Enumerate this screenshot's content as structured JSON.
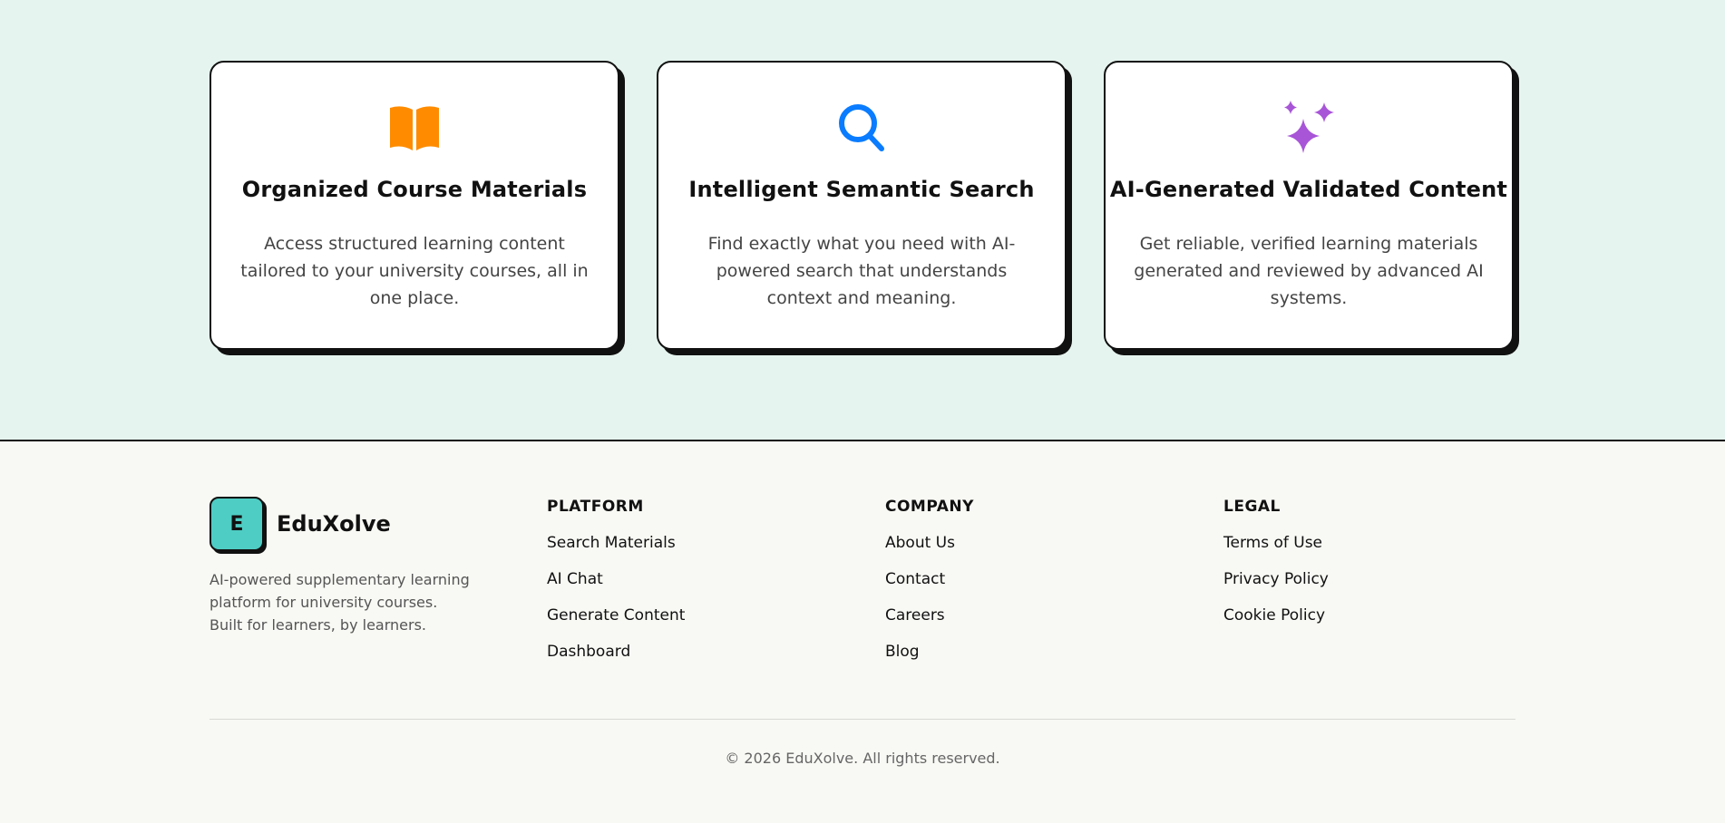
{
  "features": [
    {
      "icon": "open-book-icon",
      "icon_color": "#FF8C00",
      "title": "Organized Course Materials",
      "description": "Access structured learning content tailored to your university courses, all in one place."
    },
    {
      "icon": "search-icon",
      "icon_color": "#0A7CFF",
      "title": "Intelligent Semantic Search",
      "description": "Find exactly what you need with AI-powered search that understands context and meaning."
    },
    {
      "icon": "sparkles-icon",
      "icon_color": "#A855D8",
      "title": "AI-Generated Validated Content",
      "description": "Get reliable, verified learning materials generated and reviewed by advanced AI systems."
    }
  ],
  "footer": {
    "brand": {
      "logo_letter": "E",
      "logo_color": "#4ECDC4",
      "name": "EduXolve",
      "description_line1": "AI-powered supplementary learning platform for university courses.",
      "description_line2": "Built for learners, by learners."
    },
    "columns": [
      {
        "heading": "PLATFORM",
        "links": [
          "Search Materials",
          "AI Chat",
          "Generate Content",
          "Dashboard"
        ]
      },
      {
        "heading": "COMPANY",
        "links": [
          "About Us",
          "Contact",
          "Careers",
          "Blog"
        ]
      },
      {
        "heading": "LEGAL",
        "links": [
          "Terms of Use",
          "Privacy Policy",
          "Cookie Policy"
        ]
      }
    ],
    "copyright": "© 2026 EduXolve. All rights reserved."
  }
}
